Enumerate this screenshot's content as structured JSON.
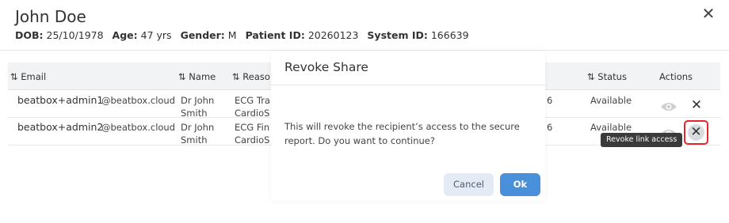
{
  "patient": {
    "name": "John Doe",
    "dob_label": "DOB:",
    "dob": "25/10/1978",
    "age_label": "Age:",
    "age": "47 yrs",
    "gender_label": "Gender:",
    "gender": "M",
    "patient_id_label": "Patient ID:",
    "patient_id": "20260123",
    "system_id_label": "System ID:",
    "system_id": "166639"
  },
  "close_glyph": "✕",
  "table": {
    "headers": {
      "email": "⇅ Email",
      "name": "⇅ Name",
      "reason": "⇅ Reaso",
      "status": "⇅ Status",
      "actions": "Actions"
    },
    "rows": [
      {
        "email_user": "beatbox+admin1",
        "email_domain": "@beatbox.cloud",
        "name_line1": "Dr John",
        "name_line2": "Smith",
        "reason_line1": "ECG Tra",
        "reason_line2": "CardioS",
        "id_fragment": "6",
        "status": "Available",
        "revoke_glyph": "✕"
      },
      {
        "email_user": "beatbox+admin2",
        "email_domain": "@beatbox.cloud",
        "name_line1": "Dr John",
        "name_line2": "Smith",
        "reason_line1": "ECG Fin",
        "reason_line2": "CardioS",
        "id_fragment": "6",
        "status": "Available",
        "revoke_glyph": "✕"
      }
    ]
  },
  "tooltip": "Revoke link access",
  "modal": {
    "title": "Revoke Share",
    "message_line1": "This will revoke the recipient’s access to the secure",
    "message_line2": "report. Do you want to continue?",
    "cancel_label": "Cancel",
    "ok_label": "Ok"
  },
  "colors": {
    "accent": "#4a8fd9",
    "highlight_border": "#e3262d"
  },
  "icons": {
    "view": "eye-icon",
    "revoke": "close-icon"
  }
}
